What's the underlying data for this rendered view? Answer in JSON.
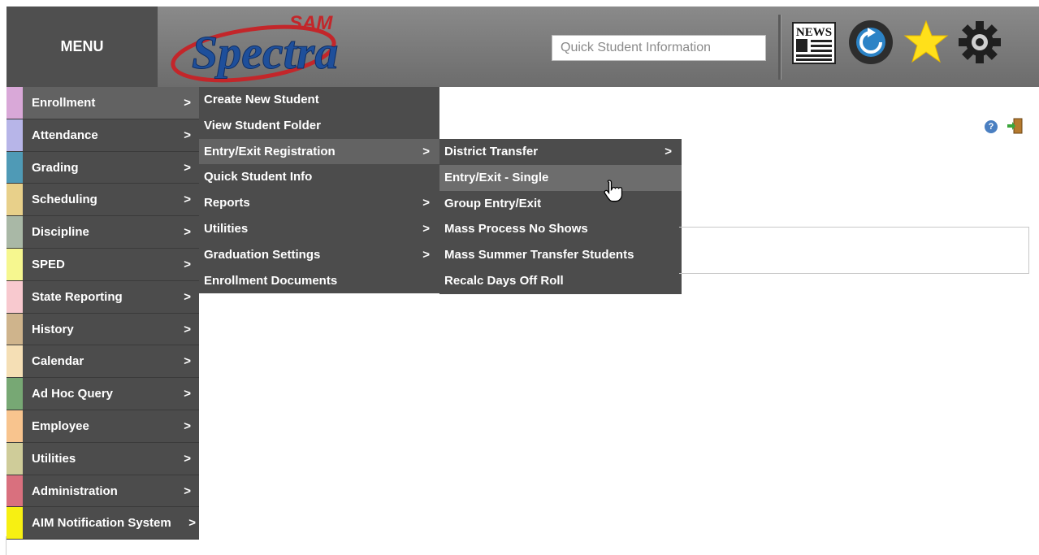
{
  "header": {
    "menu_label": "MENU",
    "logo_small": "SAM",
    "logo_large": "Spectra",
    "search_placeholder": "Quick Student Information",
    "news_label": "NEWS",
    "icons": [
      "news-icon",
      "refresh-icon",
      "favorites-star-icon",
      "settings-gear-icon"
    ]
  },
  "main_menu": [
    {
      "label": "Enrollment",
      "arrow": ">",
      "color": "#d9a8d8"
    },
    {
      "label": "Attendance",
      "arrow": ">",
      "color": "#b7b5e8"
    },
    {
      "label": "Grading",
      "arrow": ">",
      "color": "#4f9ab6"
    },
    {
      "label": "Scheduling",
      "arrow": ">",
      "color": "#e8d08a"
    },
    {
      "label": "Discipline",
      "arrow": ">",
      "color": "#a9b8a6"
    },
    {
      "label": "SPED",
      "arrow": ">",
      "color": "#f6f78f"
    },
    {
      "label": "State Reporting",
      "arrow": ">",
      "color": "#f8c9cf"
    },
    {
      "label": "History",
      "arrow": ">",
      "color": "#cfb48c"
    },
    {
      "label": "Calendar",
      "arrow": ">",
      "color": "#f5dfb5"
    },
    {
      "label": "Ad Hoc Query",
      "arrow": ">",
      "color": "#77a874"
    },
    {
      "label": "Employee",
      "arrow": ">",
      "color": "#f8c48e"
    },
    {
      "label": "Utilities",
      "arrow": ">",
      "color": "#cfcc99"
    },
    {
      "label": "Administration",
      "arrow": ">",
      "color": "#d9707e"
    },
    {
      "label": "AIM Notification System",
      "arrow": ">",
      "color": "#f7f012"
    }
  ],
  "enrollment_submenu": [
    {
      "label": "Create New Student",
      "arrow": ""
    },
    {
      "label": "View Student Folder",
      "arrow": ""
    },
    {
      "label": "Entry/Exit Registration",
      "arrow": ">"
    },
    {
      "label": "Quick Student Info",
      "arrow": ""
    },
    {
      "label": "Reports",
      "arrow": ">"
    },
    {
      "label": "Utilities",
      "arrow": ">"
    },
    {
      "label": "Graduation Settings",
      "arrow": ">"
    },
    {
      "label": "Enrollment Documents",
      "arrow": ""
    }
  ],
  "entry_exit_submenu": [
    {
      "label": "District Transfer",
      "arrow": ">"
    },
    {
      "label": "Entry/Exit - Single",
      "arrow": ""
    },
    {
      "label": "Group Entry/Exit",
      "arrow": ""
    },
    {
      "label": "Mass Process No Shows",
      "arrow": ""
    },
    {
      "label": "Mass Summer Transfer Students",
      "arrow": ""
    },
    {
      "label": "Recalc Days Off Roll",
      "arrow": ""
    }
  ],
  "page_icons": {
    "help": "?"
  }
}
